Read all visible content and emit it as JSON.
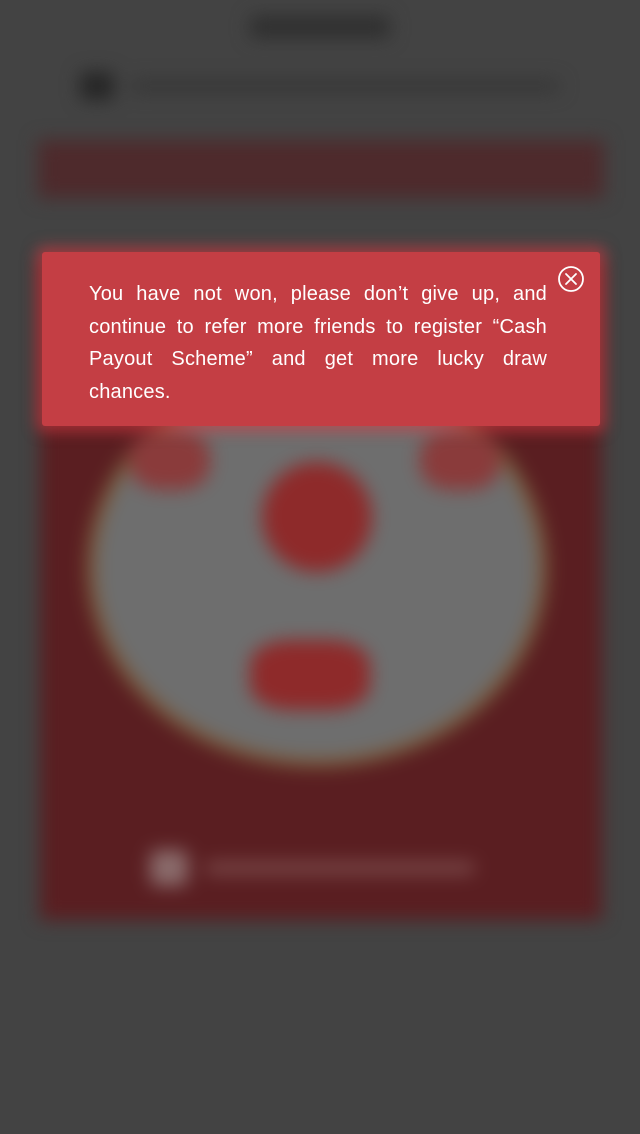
{
  "modal": {
    "message": "You have not won, please don’t give up, and continue to refer more friends to register “Cash Payout Scheme” and get more lucky draw chances.",
    "close_icon": "close-circle-icon",
    "background_color": "#c43e44"
  },
  "colors": {
    "overlay": "#434343",
    "modal_text": "#ffffff"
  }
}
